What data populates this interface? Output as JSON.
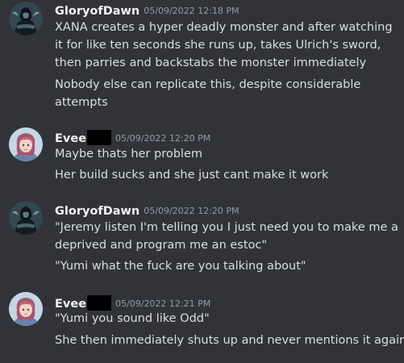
{
  "messages": [
    {
      "username": "GloryofDawn",
      "timestamp": "05/09/2022 12:18 PM",
      "redacted": false,
      "avatar": "dark-hooded-figure-avatar",
      "lines": [
        "XANA creates a hyper deadly monster and after watching",
        "it for like ten seconds she runs up, takes Ulrich's sword,",
        "then parries and backstabs the monster immediately",
        "Nobody else can replicate this, despite considerable",
        "attempts"
      ]
    },
    {
      "username": "Evee",
      "timestamp": "05/09/2022 12:20 PM",
      "redacted": true,
      "avatar": "pink-haired-girl-avatar",
      "lines": [
        "Maybe thats her problem",
        "Her build sucks and she just cant make it work"
      ]
    },
    {
      "username": "GloryofDawn",
      "timestamp": "05/09/2022 12:20 PM",
      "redacted": false,
      "avatar": "dark-hooded-figure-avatar",
      "lines": [
        "\"Jeremy listen I'm telling you I just need you to make me a",
        "deprived and program me an estoc\"",
        "\"Yumi what the fuck are you talking about\""
      ]
    },
    {
      "username": "Evee",
      "timestamp": "05/09/2022 12:21 PM",
      "redacted": true,
      "avatar": "pink-haired-girl-avatar",
      "lines": [
        "\"Yumi you sound like Odd\"",
        "She then immediately shuts up and never mentions it again"
      ]
    }
  ]
}
